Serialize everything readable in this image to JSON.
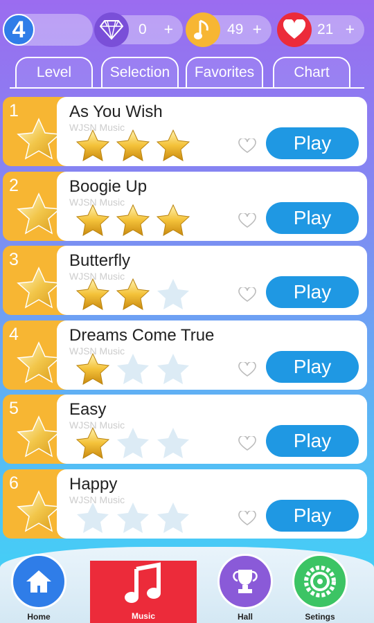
{
  "header": {
    "level": "4",
    "gems": {
      "value": "0",
      "plus": "+",
      "icon": "diamond-icon"
    },
    "notes": {
      "value": "49",
      "plus": "+",
      "icon": "music-note-icon"
    },
    "lives": {
      "value": "21",
      "plus": "+",
      "icon": "heart-icon"
    }
  },
  "tabs": [
    {
      "label": "Level"
    },
    {
      "label": "Selection"
    },
    {
      "label": "Favorites"
    },
    {
      "label": "Chart"
    }
  ],
  "songs": [
    {
      "rank": "1",
      "title": "As You Wish",
      "artist": "WJSN Music",
      "stars": 3,
      "play": "Play"
    },
    {
      "rank": "2",
      "title": "Boogie Up",
      "artist": "WJSN Music",
      "stars": 3,
      "play": "Play"
    },
    {
      "rank": "3",
      "title": "Butterfly",
      "artist": "WJSN Music",
      "stars": 2,
      "play": "Play"
    },
    {
      "rank": "4",
      "title": "Dreams Come True",
      "artist": "WJSN Music",
      "stars": 1,
      "play": "Play"
    },
    {
      "rank": "5",
      "title": "Easy",
      "artist": "WJSN Music",
      "stars": 1,
      "play": "Play"
    },
    {
      "rank": "6",
      "title": "Happy",
      "artist": "WJSN Music",
      "stars": 0,
      "play": "Play"
    }
  ],
  "nav": {
    "home": "Home",
    "music": "Music",
    "hall": "Hall",
    "settings": "Setings"
  },
  "colors": {
    "accent": "#1f98e3",
    "rank_bg": "#f7b633",
    "music_active": "#ec2b3a"
  }
}
